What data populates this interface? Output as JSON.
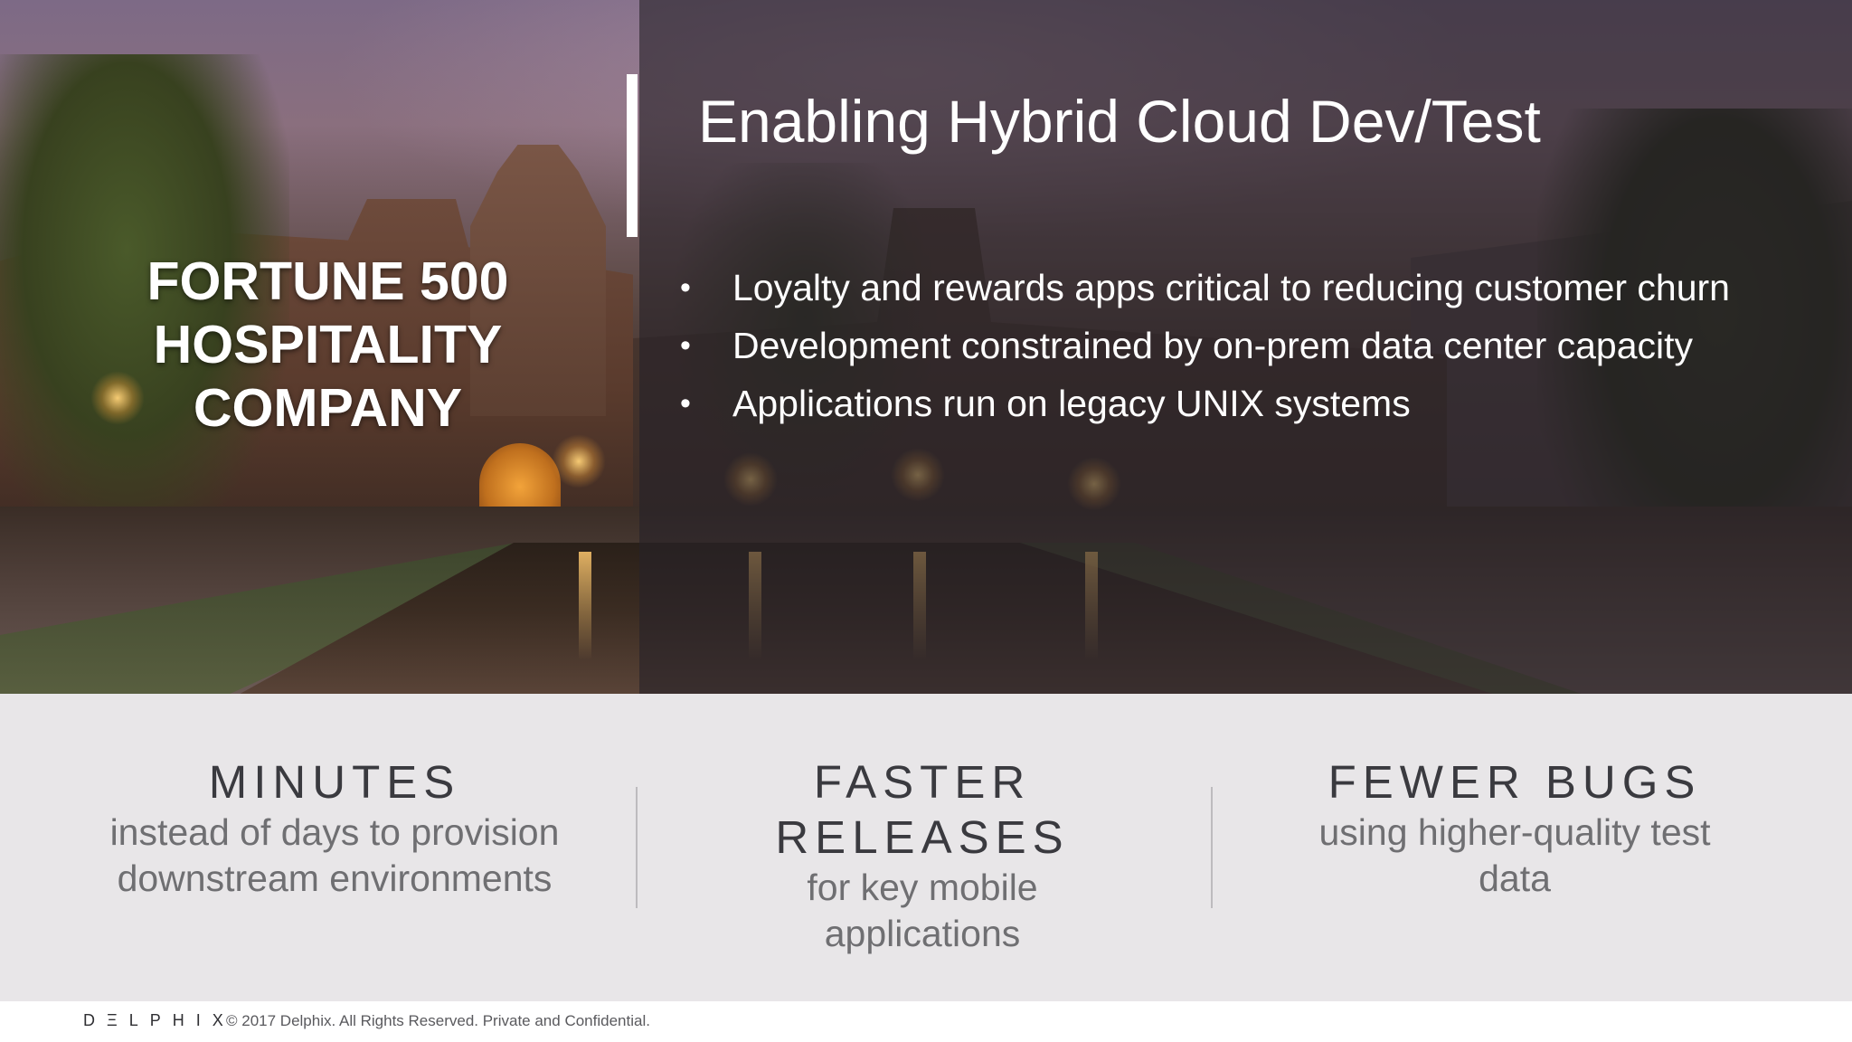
{
  "hero": {
    "company_lines": [
      "FORTUNE 500",
      "HOSPITALITY",
      "COMPANY"
    ],
    "title": "Enabling Hybrid Cloud Dev/Test",
    "bullet_symbol": "•",
    "bullets": [
      "Loyalty and rewards apps critical to reducing customer churn",
      "Development constrained by on-prem data center capacity",
      "Applications run on legacy UNIX systems"
    ]
  },
  "stats": [
    {
      "headline_lines": [
        "MINUTES"
      ],
      "description_lines": [
        "instead of days to provision",
        "downstream environments"
      ]
    },
    {
      "headline_lines": [
        "FASTER",
        "RELEASES"
      ],
      "description_lines": [
        "for key mobile",
        "applications"
      ]
    },
    {
      "headline_lines": [
        "FEWER BUGS"
      ],
      "description_lines": [
        "using higher-quality test",
        "data"
      ]
    }
  ],
  "footer": {
    "logo_text": "DΞLPHIX",
    "copyright": "© 2017 Delphix. All Rights Reserved. Private and Confidential."
  },
  "colors": {
    "overlay_panel": "#26222899",
    "stats_background": "#e8e6e8",
    "headline_text": "#3a3a3f",
    "description_text": "#6f6f72",
    "divider": "#bdbbbe"
  },
  "icons": {
    "bullet": "bullet-dot-icon",
    "accent": "accent-bar"
  }
}
